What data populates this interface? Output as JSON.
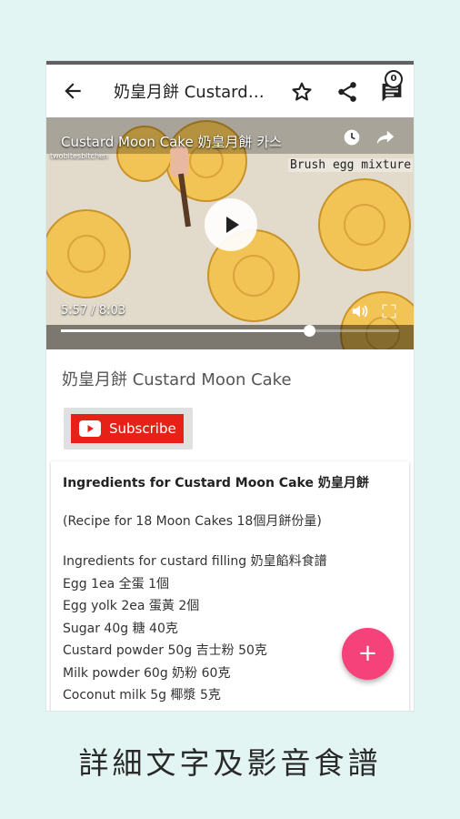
{
  "appbar": {
    "title": "奶皇月餅 Custard Moon Cake 奶皇月餅 카스",
    "comment_count": "0"
  },
  "video": {
    "title": "Custard Moon Cake 奶皇月餅 카스",
    "channel": "twobitesbitchen",
    "caption": "Brush egg mixture",
    "current_time": "5:57",
    "duration": "8:03",
    "time_display": "5:57 / 8:03",
    "progress": 0.735
  },
  "recipe": {
    "title": "奶皇月餅 Custard Moon Cake",
    "subscribe_label": "Subscribe",
    "heading": "Ingredients for Custard Moon Cake 奶皇月餅",
    "note": "(Recipe for 18 Moon Cakes 18個月餅份量)",
    "lines": [
      "Ingredients for custard filling 奶皇餡料食譜",
      "Egg 1ea 全蛋 1個",
      "Egg yolk 2ea 蛋黃 2個",
      "Sugar 40g 糖 40克",
      "Custard powder 50g 吉士粉 50克",
      "Milk powder 60g 奶粉 60克",
      "Coconut milk 5g 椰漿 5克"
    ]
  },
  "fab_label": "+",
  "banner_caption": "詳細文字及影音食譜",
  "colors": {
    "background": "#e3f5f3",
    "fab": "#f5427a",
    "subscribe_red": "#e62117"
  }
}
